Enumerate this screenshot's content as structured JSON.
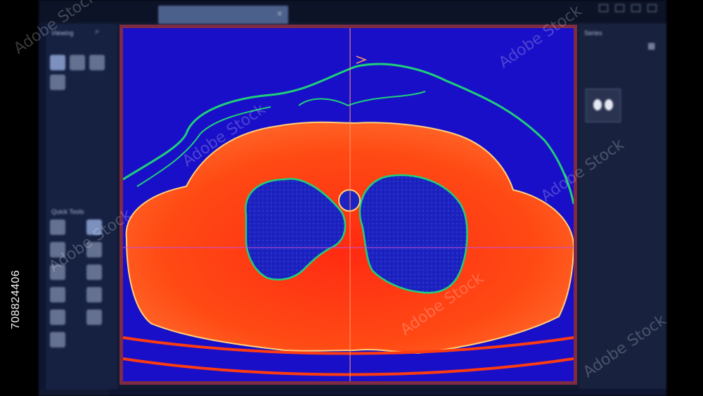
{
  "stock_id": "708824406",
  "watermark": "Adobe Stock",
  "app": {
    "tab_title": "",
    "left_panel_headers": [
      "Viewing",
      "Quick Tools"
    ],
    "right_panel_headers": [
      "Series"
    ]
  },
  "colors": {
    "viewer_border": "#7e2b45",
    "background_blue": "#1a0fc8",
    "body_red": "#ff3c10",
    "lung_blue": "#1a2cb8",
    "skin_green": "#1fd07a",
    "crosshair": "#ff9a6a"
  },
  "icons": [
    "search-icon",
    "gear-icon",
    "grid-icon",
    "close-icon",
    "window-controls-icon"
  ]
}
